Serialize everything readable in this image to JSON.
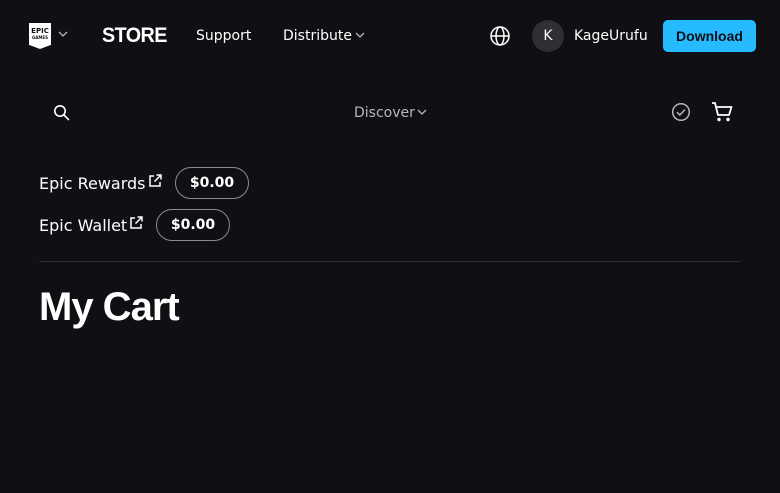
{
  "header": {
    "logo_top": "EPIC",
    "logo_bottom": "GAMES",
    "store_label": "STORE",
    "nav": {
      "support_label": "Support",
      "distribute_label": "Distribute"
    },
    "user": {
      "avatar_initial": "K",
      "username": "KageUrufu"
    },
    "download_label": "Download"
  },
  "subnav": {
    "discover_label": "Discover"
  },
  "balances": {
    "rewards": {
      "label": "Epic Rewards",
      "amount": "$0.00"
    },
    "wallet": {
      "label": "Epic Wallet",
      "amount": "$0.00"
    }
  },
  "main": {
    "title": "My Cart"
  },
  "colors": {
    "background": "#101014",
    "accent": "#26bbff",
    "text": "#ffffff",
    "muted_text": "#b8b8bc"
  },
  "icons": [
    "chevron-down-icon",
    "globe-icon",
    "search-icon",
    "check-circle-icon",
    "cart-icon",
    "external-link-icon"
  ]
}
